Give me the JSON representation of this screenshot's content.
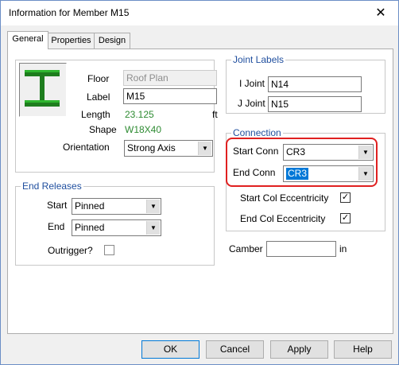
{
  "window": {
    "title": "Information for Member M15",
    "close_glyph": "✕"
  },
  "tabs": [
    {
      "label": "General",
      "active": true
    },
    {
      "label": "Properties",
      "active": false
    },
    {
      "label": "Design",
      "active": false
    }
  ],
  "member": {
    "icon": "i-beam-icon",
    "floor_label": "Floor",
    "floor_value": "Roof Plan",
    "label_label": "Label",
    "label_value": "M15",
    "length_label": "Length",
    "length_value": "23.125",
    "length_unit": "ft",
    "shape_label": "Shape",
    "shape_value": "W18X40",
    "orientation_label": "Orientation",
    "orientation_value": "Strong Axis"
  },
  "end_releases": {
    "title": "End Releases",
    "start_label": "Start",
    "start_value": "Pinned",
    "end_label": "End",
    "end_value": "Pinned",
    "outrigger_label": "Outrigger?",
    "outrigger_checked": false
  },
  "joint_labels": {
    "title": "Joint Labels",
    "i_label": "I Joint",
    "i_value": "N14",
    "j_label": "J Joint",
    "j_value": "N15"
  },
  "connection": {
    "title": "Connection",
    "start_label": "Start Conn",
    "start_value": "CR3",
    "end_label": "End Conn",
    "end_value": "CR3",
    "start_ecc_label": "Start Col Eccentricity",
    "start_ecc_checked": true,
    "end_ecc_label": "End Col Eccentricity",
    "end_ecc_checked": true,
    "check_glyph": "✓"
  },
  "camber": {
    "label": "Camber",
    "value": "",
    "unit": "in"
  },
  "buttons": {
    "ok": "OK",
    "cancel": "Cancel",
    "apply": "Apply",
    "help": "Help"
  },
  "colors": {
    "accent": "#0078d7",
    "highlight": "#e02020",
    "group_title": "#1f4e9e",
    "value_green": "#2e8b32"
  }
}
